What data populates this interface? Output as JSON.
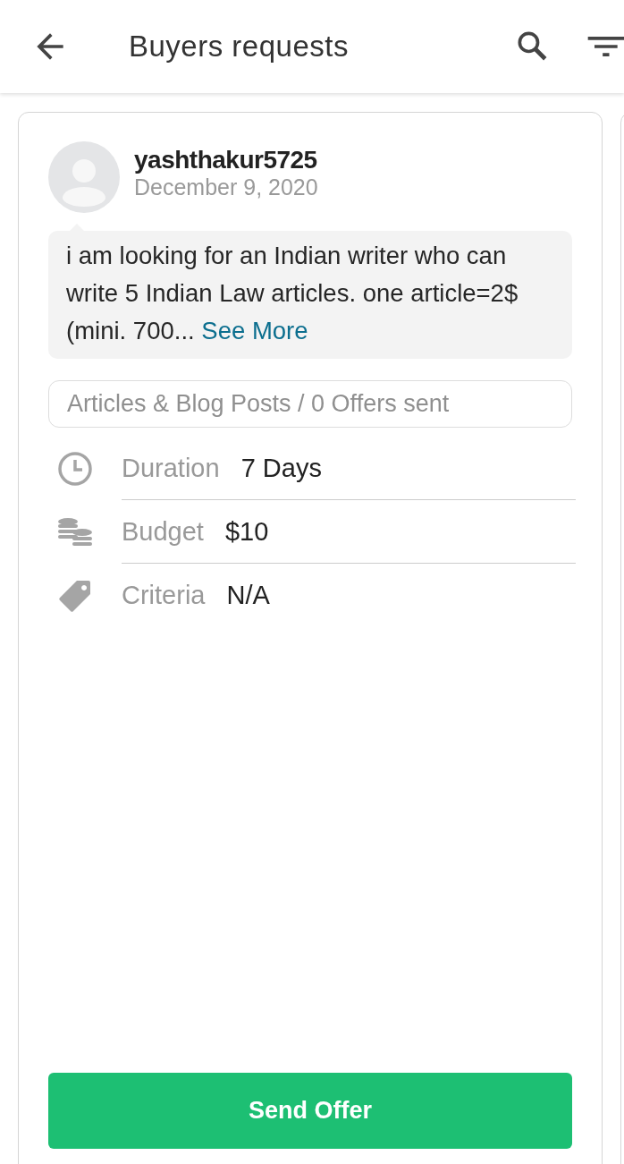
{
  "app_bar": {
    "title": "Buyers requests"
  },
  "request": {
    "username": "yashthakur5725",
    "date": "December 9, 2020",
    "description": "i am looking for an Indian writer who can write 5 Indian Law articles. one article=2$ (mini. 700...",
    "see_more": "See More",
    "category": "Articles & Blog Posts / 0 Offers sent",
    "details": [
      {
        "kind": "clock",
        "label": "Duration",
        "value": "7 Days"
      },
      {
        "kind": "coins",
        "label": "Budget",
        "value": "$10"
      },
      {
        "kind": "tag",
        "label": "Criteria",
        "value": "N/A"
      }
    ],
    "action": "Send Offer"
  }
}
